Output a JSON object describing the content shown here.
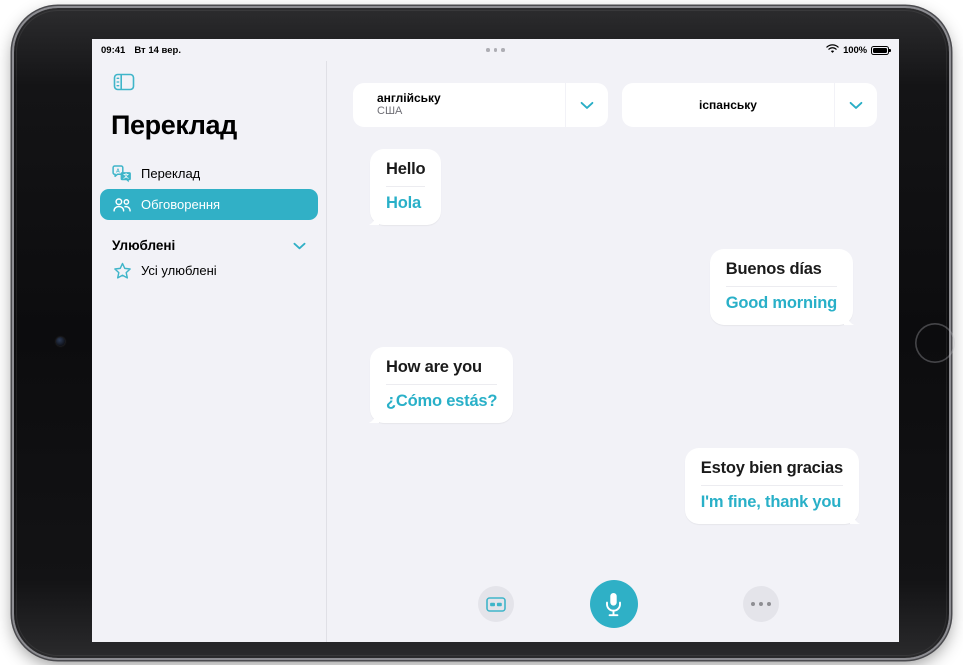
{
  "device": {
    "kind": "ipad-landscape"
  },
  "status_bar": {
    "time": "09:41",
    "date": "Вт 14 вер.",
    "battery_percent": "100%",
    "wifi_icon": "wifi-icon",
    "battery_icon": "battery-full-icon",
    "multitask_icon": "multitasking-handle-icon"
  },
  "sidebar": {
    "toggle_icon": "sidebar-toggle-icon",
    "title": "Переклад",
    "items": [
      {
        "label": "Переклад",
        "icon": "translate-icon",
        "selected": false
      },
      {
        "label": "Обговорення",
        "icon": "people-conversation-icon",
        "selected": true
      }
    ],
    "section": {
      "label": "Улюблені",
      "chevron_icon": "chevron-down-icon",
      "items": [
        {
          "label": "Усі улюблені",
          "icon": "star-outline-icon"
        }
      ]
    }
  },
  "main": {
    "source_language": {
      "name": "англійську",
      "region": "США",
      "chevron_icon": "chevron-down-icon"
    },
    "target_language": {
      "name": "іспанську",
      "region": "",
      "chevron_icon": "chevron-down-icon"
    },
    "messages": [
      {
        "side": "left",
        "source": "Hello",
        "translation": "Hola"
      },
      {
        "side": "right",
        "source": "Buenos días",
        "translation": "Good morning"
      },
      {
        "side": "left",
        "source": "How are you",
        "translation": "¿Cómo estás?"
      },
      {
        "side": "right",
        "source": "Estoy bien gracias",
        "translation": "I'm fine, thank you"
      }
    ],
    "toolbar": {
      "card_button_icon": "face-to-face-card-icon",
      "mic_button_icon": "microphone-icon",
      "more_button_icon": "more-ellipsis-icon"
    }
  },
  "colors": {
    "accent": "#31b0c6",
    "translation_text": "#29b0c8",
    "screen_background": "#f2f2f7",
    "bubble_background": "#ffffff"
  }
}
